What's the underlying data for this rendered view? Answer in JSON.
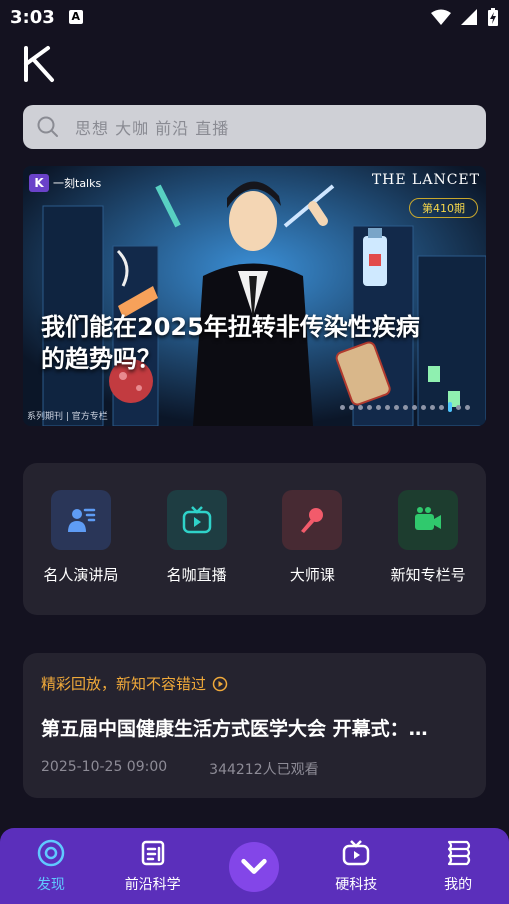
{
  "status_bar": {
    "time": "3:03",
    "notification_icon": "A"
  },
  "search": {
    "placeholder": "思想 大咖 前沿 直播"
  },
  "banner": {
    "brand": "一刻talks",
    "partner": "THE LANCET",
    "issue": "第410期",
    "headline": "我们能在2025年扭转非传染性疾病的趋势吗？",
    "subtitle": "系列期刊 | 官方专栏"
  },
  "quick_links": [
    {
      "label": "名人演讲局",
      "icon": "speaker-icon",
      "color": "#5e9cf5"
    },
    {
      "label": "名咖直播",
      "icon": "tv-icon",
      "color": "#2fd3c9"
    },
    {
      "label": "大师课",
      "icon": "microphone-icon",
      "color": "#f25b6b"
    },
    {
      "label": "新知专栏号",
      "icon": "video-camera-icon",
      "color": "#30c96d"
    }
  ],
  "replay": {
    "tag": "精彩回放，新知不容错过",
    "title": "第五届中国健康生活方式医学大会 开幕式：…",
    "date": "2025-10-25 09:00",
    "views": "344212人已观看"
  },
  "tabs": [
    {
      "label": "发现",
      "icon": "discover-icon",
      "active": true
    },
    {
      "label": "前沿科学",
      "icon": "document-icon",
      "active": false
    },
    {
      "label": "",
      "icon": "chevron-down-icon",
      "active": false
    },
    {
      "label": "硬科技",
      "icon": "tv-icon",
      "active": false
    },
    {
      "label": "我的",
      "icon": "profile-icon",
      "active": false
    }
  ],
  "colors": {
    "accent": "#5b2fbb",
    "active_tab": "#60c9ff",
    "tag": "#f0a93a"
  }
}
